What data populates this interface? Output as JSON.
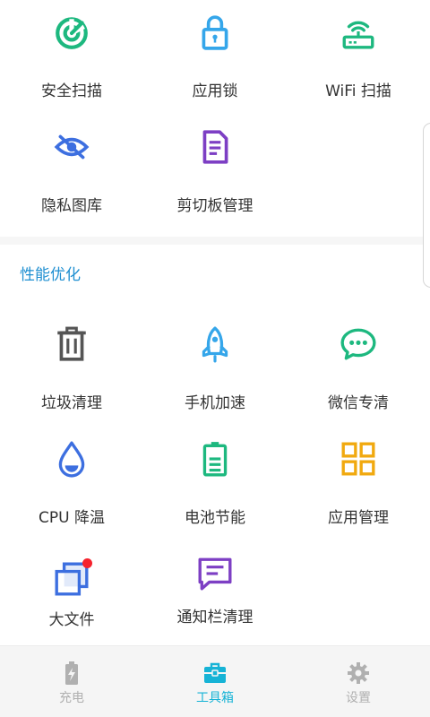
{
  "security_tools": [
    {
      "label": "安全扫描",
      "icon": "shield-scan-icon",
      "color": "#1db87f"
    },
    {
      "label": "应用锁",
      "icon": "padlock-icon",
      "color": "#35a6ea"
    },
    {
      "label": "WiFi 扫描",
      "icon": "wifi-router-icon",
      "color": "#1db87f"
    },
    {
      "label": "隐私图库",
      "icon": "eye-off-icon",
      "color": "#3d6fe0"
    },
    {
      "label": "剪切板管理",
      "icon": "clipboard-doc-icon",
      "color": "#7d3fc4"
    }
  ],
  "performance": {
    "title": "性能优化",
    "tools": [
      {
        "label": "垃圾清理",
        "icon": "trash-icon",
        "color": "#555555"
      },
      {
        "label": "手机加速",
        "icon": "rocket-icon",
        "color": "#35a6ea"
      },
      {
        "label": "微信专清",
        "icon": "wechat-icon",
        "color": "#1db87f"
      },
      {
        "label": "CPU 降温",
        "icon": "droplet-icon",
        "color": "#3d6fe0"
      },
      {
        "label": "电池节能",
        "icon": "battery-icon",
        "color": "#1db87f"
      },
      {
        "label": "应用管理",
        "icon": "apps-grid-icon",
        "color": "#f1a90f"
      },
      {
        "label": "大文件",
        "icon": "files-stack-icon",
        "color": "#3d6fe0"
      },
      {
        "label": "通知栏清理",
        "icon": "notification-bubble-icon",
        "color": "#7d3fc4"
      }
    ]
  },
  "bottom_nav": [
    {
      "label": "充电",
      "icon": "battery-charge-icon",
      "active": false
    },
    {
      "label": "工具箱",
      "icon": "toolbox-icon",
      "active": true
    },
    {
      "label": "设置",
      "icon": "gear-icon",
      "active": false
    }
  ],
  "colors": {
    "accent": "#16b3d6",
    "section_title": "#1f8fd1",
    "badge": "#f5222d",
    "inactive": "#b0b0b0"
  }
}
